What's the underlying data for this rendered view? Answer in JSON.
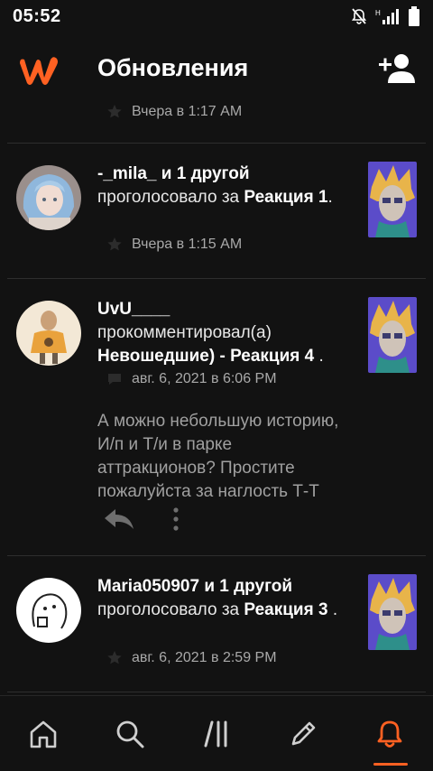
{
  "status_bar": {
    "time": "05:52"
  },
  "header": {
    "title": "Обновления"
  },
  "top_partial": {
    "timestamp": "Вчера в 1:17 AM"
  },
  "items": [
    {
      "user": "-_mila_ и 1 другой",
      "action": "проголосовало за",
      "story": "Реакция 1",
      "suffix": ".",
      "timestamp": "Вчера в 1:15 AM"
    },
    {
      "user": "UvU____",
      "action": "прокомментировал(а)",
      "story": "Невошедшие) - Реакция 4",
      "suffix": ".",
      "timestamp": "авг. 6, 2021 в 6:06 PM",
      "comment": "А можно небольшую историю, И/п и Т/и в парке аттракционов? Простите пожалуйста за наглость Т-Т"
    },
    {
      "user": "Maria050907 и 1 другой",
      "action": "проголосовало за",
      "story": "Реакция 3",
      "suffix": ".",
      "timestamp": "авг. 6, 2021 в 2:59 PM"
    }
  ],
  "icons": {
    "logo": "wattpad-logo-icon",
    "add_user": "add-user-icon",
    "star": "star-icon",
    "comment": "comment-icon",
    "reply": "reply-icon",
    "more": "more-vertical-icon",
    "nav": [
      "home-icon",
      "search-icon",
      "library-icon",
      "write-icon",
      "notifications-icon"
    ]
  },
  "colors": {
    "accent": "#ff6122",
    "background": "#121212"
  }
}
